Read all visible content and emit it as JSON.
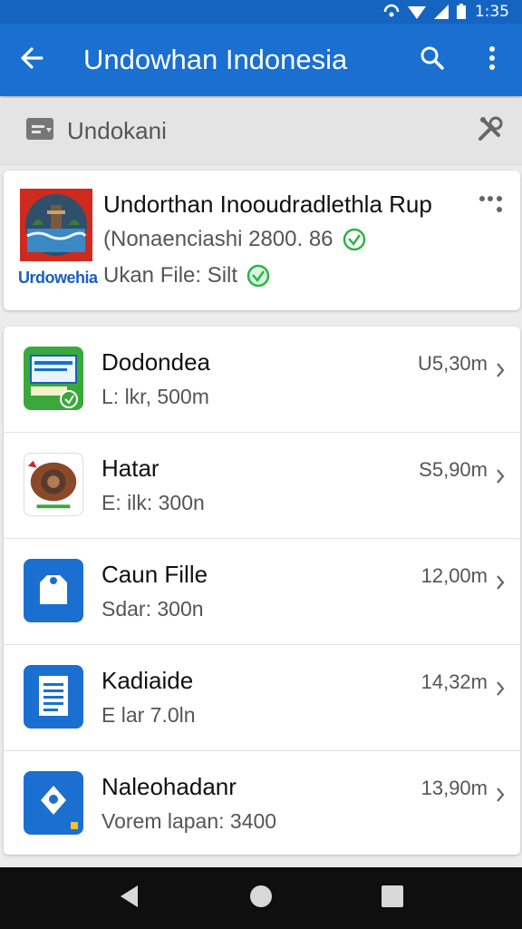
{
  "status_bar": {
    "time": "1:35",
    "icons": [
      "signal-icon",
      "wifi-icon",
      "cell-icon",
      "battery-icon"
    ]
  },
  "app_bar": {
    "title": "Undowhan Indonesia",
    "icons": [
      "back-arrow-icon",
      "search-icon",
      "more-vert-icon"
    ]
  },
  "section": {
    "label": "Undokani",
    "icons": [
      "folder-icon",
      "tools-icon"
    ]
  },
  "header_card": {
    "brand": "Urdowehia",
    "title": "Undorthan Inooudradlethla  Rup",
    "line1": "(Nonaenciashi  2800. 86",
    "line2": "Ukan File: Silt",
    "accent": "#1a6fd1"
  },
  "items": [
    {
      "name": "Dodondea",
      "sub": "L: lkr, 500m",
      "size": "U5,30m",
      "icon": "document-green-icon",
      "color": "#3aa83a"
    },
    {
      "name": "Hatar",
      "sub": "E: ilk: 300n",
      "size": "S5,90m",
      "icon": "wooden-box-icon",
      "color": "#8a4a2a"
    },
    {
      "name": "Caun Fille",
      "sub": "Sdar: 300n",
      "size": "12,00m",
      "icon": "blue-bag-icon",
      "color": "#1a6fd1"
    },
    {
      "name": "Kadiaide",
      "sub": "E lar  7.0ln",
      "size": "14,32m",
      "icon": "blue-document-icon",
      "color": "#1a6fd1"
    },
    {
      "name": "Naleohadanr",
      "sub": "Vorem lapan: 3400",
      "size": "13,90m",
      "icon": "blue-map-pin-icon",
      "color": "#1a6fd1"
    }
  ],
  "nav": {
    "icons": [
      "back-triangle-icon",
      "home-circle-icon",
      "recents-square-icon"
    ]
  }
}
